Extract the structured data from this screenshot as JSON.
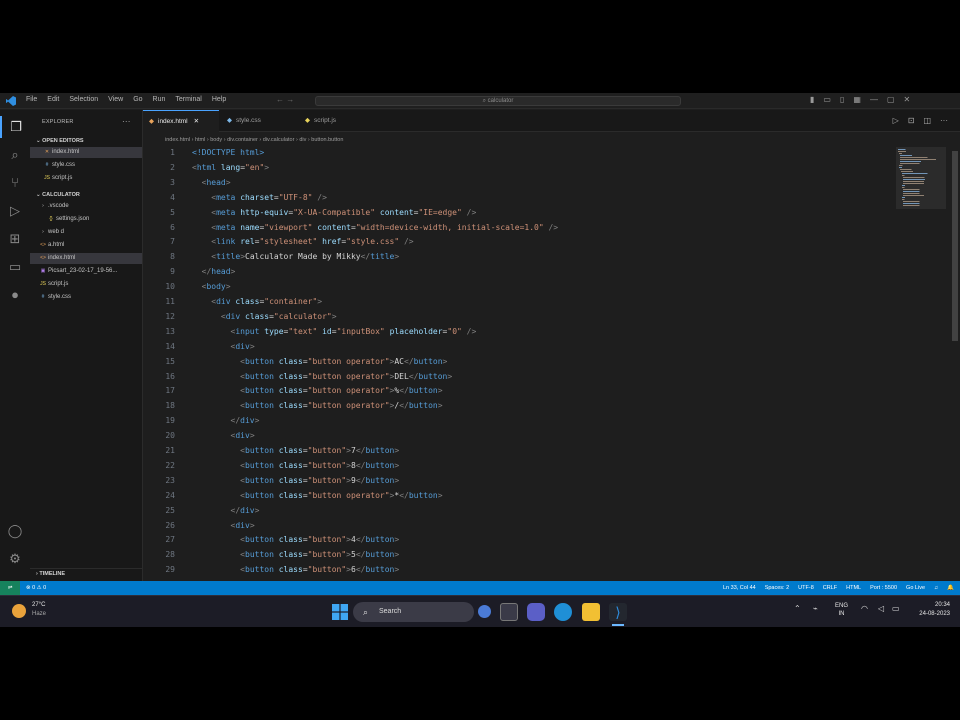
{
  "titlebar": {
    "menu": [
      "File",
      "Edit",
      "Selection",
      "View",
      "Go",
      "Run",
      "Terminal",
      "Help"
    ],
    "search_text": "calculator",
    "nav": "← →",
    "window_controls": [
      "—",
      "▢",
      "✕"
    ]
  },
  "sidebar": {
    "title": "EXPLORER",
    "more": "···",
    "open_editors_header": "OPEN EDITORS",
    "open_editors": [
      {
        "icon": "✕",
        "name": "index.html",
        "color": "#e8a35b"
      },
      {
        "icon": "#",
        "name": "style.css",
        "color": "#7db8e8"
      },
      {
        "icon": "JS",
        "name": "script.js",
        "color": "#e8d35b"
      }
    ],
    "project_header": "CALCULATOR",
    "tree": [
      {
        "icon": "›",
        "name": ".vscode",
        "color": "#c5c5c5",
        "indent": 10
      },
      {
        "icon": "{}",
        "name": "settings.json",
        "color": "#e8d35b",
        "indent": 18
      },
      {
        "icon": "›",
        "name": "web d",
        "color": "#c5c5c5",
        "indent": 10
      },
      {
        "icon": "<>",
        "name": "a.html",
        "color": "#e8a35b",
        "indent": 10
      },
      {
        "icon": "<>",
        "name": "index.html",
        "color": "#e8a35b",
        "indent": 10,
        "selected": true
      },
      {
        "icon": "▣",
        "name": "Picsart_23-02-17_19-56...",
        "color": "#b07de8",
        "indent": 10
      },
      {
        "icon": "JS",
        "name": "script.js",
        "color": "#e8d35b",
        "indent": 10
      },
      {
        "icon": "#",
        "name": "style.css",
        "color": "#7db8e8",
        "indent": 10
      }
    ],
    "timeline": "TIMELINE"
  },
  "tabs": [
    {
      "name": "index.html",
      "close": "✕",
      "active": true,
      "color": "#e8a35b"
    },
    {
      "name": "style.css",
      "close": "",
      "active": false,
      "color": "#7db8e8"
    },
    {
      "name": "script.js",
      "close": "",
      "active": false,
      "color": "#e8d35b"
    }
  ],
  "breadcrumb": [
    "index.html",
    "html",
    "body",
    "div.container",
    "div.calculator",
    "div",
    "button.button"
  ],
  "code_lines": [
    [
      [
        "tg",
        "<!DOCTYPE html>"
      ]
    ],
    [
      [
        "br",
        "<"
      ],
      [
        "tg",
        "html "
      ],
      [
        "at",
        "lang"
      ],
      [
        "tx",
        "="
      ],
      [
        "st",
        "\"en\""
      ],
      [
        "br",
        ">"
      ]
    ],
    [
      [
        "tx",
        "  "
      ],
      [
        "br",
        "<"
      ],
      [
        "tg",
        "head"
      ],
      [
        "br",
        ">"
      ]
    ],
    [
      [
        "tx",
        "    "
      ],
      [
        "br",
        "<"
      ],
      [
        "tg",
        "meta "
      ],
      [
        "at",
        "charset"
      ],
      [
        "tx",
        "="
      ],
      [
        "st",
        "\"UTF-8\""
      ],
      [
        "br",
        " />"
      ]
    ],
    [
      [
        "tx",
        "    "
      ],
      [
        "br",
        "<"
      ],
      [
        "tg",
        "meta "
      ],
      [
        "at",
        "http-equiv"
      ],
      [
        "tx",
        "="
      ],
      [
        "st",
        "\"X-UA-Compatible\""
      ],
      [
        "tx",
        " "
      ],
      [
        "at",
        "content"
      ],
      [
        "tx",
        "="
      ],
      [
        "st",
        "\"IE=edge\""
      ],
      [
        "br",
        " />"
      ]
    ],
    [
      [
        "tx",
        "    "
      ],
      [
        "br",
        "<"
      ],
      [
        "tg",
        "meta "
      ],
      [
        "at",
        "name"
      ],
      [
        "tx",
        "="
      ],
      [
        "st",
        "\"viewport\""
      ],
      [
        "tx",
        " "
      ],
      [
        "at",
        "content"
      ],
      [
        "tx",
        "="
      ],
      [
        "st",
        "\"width=device-width, initial-scale=1.0\""
      ],
      [
        "br",
        " />"
      ]
    ],
    [
      [
        "tx",
        "    "
      ],
      [
        "br",
        "<"
      ],
      [
        "tg",
        "link "
      ],
      [
        "at",
        "rel"
      ],
      [
        "tx",
        "="
      ],
      [
        "st",
        "\"stylesheet\""
      ],
      [
        "tx",
        " "
      ],
      [
        "at",
        "href"
      ],
      [
        "tx",
        "="
      ],
      [
        "st",
        "\"style.css\""
      ],
      [
        "br",
        " />"
      ]
    ],
    [
      [
        "tx",
        "    "
      ],
      [
        "br",
        "<"
      ],
      [
        "tg",
        "title"
      ],
      [
        "br",
        ">"
      ],
      [
        "tx",
        "Calculator Made by Mikky"
      ],
      [
        "br",
        "</"
      ],
      [
        "tg",
        "title"
      ],
      [
        "br",
        ">"
      ]
    ],
    [
      [
        "tx",
        "  "
      ],
      [
        "br",
        "</"
      ],
      [
        "tg",
        "head"
      ],
      [
        "br",
        ">"
      ]
    ],
    [
      [
        "tx",
        "  "
      ],
      [
        "br",
        "<"
      ],
      [
        "tg",
        "body"
      ],
      [
        "br",
        ">"
      ]
    ],
    [
      [
        "tx",
        "    "
      ],
      [
        "br",
        "<"
      ],
      [
        "tg",
        "div "
      ],
      [
        "at",
        "class"
      ],
      [
        "tx",
        "="
      ],
      [
        "st",
        "\"container\""
      ],
      [
        "br",
        ">"
      ]
    ],
    [
      [
        "tx",
        "      "
      ],
      [
        "br",
        "<"
      ],
      [
        "tg",
        "div "
      ],
      [
        "at",
        "class"
      ],
      [
        "tx",
        "="
      ],
      [
        "st",
        "\"calculator\""
      ],
      [
        "br",
        ">"
      ]
    ],
    [
      [
        "tx",
        "        "
      ],
      [
        "br",
        "<"
      ],
      [
        "tg",
        "input "
      ],
      [
        "at",
        "type"
      ],
      [
        "tx",
        "="
      ],
      [
        "st",
        "\"text\""
      ],
      [
        "tx",
        " "
      ],
      [
        "at",
        "id"
      ],
      [
        "tx",
        "="
      ],
      [
        "st",
        "\"inputBox\""
      ],
      [
        "tx",
        " "
      ],
      [
        "at",
        "placeholder"
      ],
      [
        "tx",
        "="
      ],
      [
        "st",
        "\"0\""
      ],
      [
        "br",
        " />"
      ]
    ],
    [
      [
        "tx",
        "        "
      ],
      [
        "br",
        "<"
      ],
      [
        "tg",
        "div"
      ],
      [
        "br",
        ">"
      ]
    ],
    [
      [
        "tx",
        "          "
      ],
      [
        "br",
        "<"
      ],
      [
        "tg",
        "button "
      ],
      [
        "at",
        "class"
      ],
      [
        "tx",
        "="
      ],
      [
        "st",
        "\"button operator\""
      ],
      [
        "br",
        ">"
      ],
      [
        "tx",
        "AC"
      ],
      [
        "br",
        "</"
      ],
      [
        "tg",
        "button"
      ],
      [
        "br",
        ">"
      ]
    ],
    [
      [
        "tx",
        "          "
      ],
      [
        "br",
        "<"
      ],
      [
        "tg",
        "button "
      ],
      [
        "at",
        "class"
      ],
      [
        "tx",
        "="
      ],
      [
        "st",
        "\"button operator\""
      ],
      [
        "br",
        ">"
      ],
      [
        "tx",
        "DEL"
      ],
      [
        "br",
        "</"
      ],
      [
        "tg",
        "button"
      ],
      [
        "br",
        ">"
      ]
    ],
    [
      [
        "tx",
        "          "
      ],
      [
        "br",
        "<"
      ],
      [
        "tg",
        "button "
      ],
      [
        "at",
        "class"
      ],
      [
        "tx",
        "="
      ],
      [
        "st",
        "\"button operator\""
      ],
      [
        "br",
        ">"
      ],
      [
        "tx",
        "%"
      ],
      [
        "br",
        "</"
      ],
      [
        "tg",
        "button"
      ],
      [
        "br",
        ">"
      ]
    ],
    [
      [
        "tx",
        "          "
      ],
      [
        "br",
        "<"
      ],
      [
        "tg",
        "button "
      ],
      [
        "at",
        "class"
      ],
      [
        "tx",
        "="
      ],
      [
        "st",
        "\"button operator\""
      ],
      [
        "br",
        ">"
      ],
      [
        "tx",
        "/"
      ],
      [
        "br",
        "</"
      ],
      [
        "tg",
        "button"
      ],
      [
        "br",
        ">"
      ]
    ],
    [
      [
        "tx",
        "        "
      ],
      [
        "br",
        "</"
      ],
      [
        "tg",
        "div"
      ],
      [
        "br",
        ">"
      ]
    ],
    [
      [
        "tx",
        "        "
      ],
      [
        "br",
        "<"
      ],
      [
        "tg",
        "div"
      ],
      [
        "br",
        ">"
      ]
    ],
    [
      [
        "tx",
        "          "
      ],
      [
        "br",
        "<"
      ],
      [
        "tg",
        "button "
      ],
      [
        "at",
        "class"
      ],
      [
        "tx",
        "="
      ],
      [
        "st",
        "\"button\""
      ],
      [
        "br",
        ">"
      ],
      [
        "tx",
        "7"
      ],
      [
        "br",
        "</"
      ],
      [
        "tg",
        "button"
      ],
      [
        "br",
        ">"
      ]
    ],
    [
      [
        "tx",
        "          "
      ],
      [
        "br",
        "<"
      ],
      [
        "tg",
        "button "
      ],
      [
        "at",
        "class"
      ],
      [
        "tx",
        "="
      ],
      [
        "st",
        "\"button\""
      ],
      [
        "br",
        ">"
      ],
      [
        "tx",
        "8"
      ],
      [
        "br",
        "</"
      ],
      [
        "tg",
        "button"
      ],
      [
        "br",
        ">"
      ]
    ],
    [
      [
        "tx",
        "          "
      ],
      [
        "br",
        "<"
      ],
      [
        "tg",
        "button "
      ],
      [
        "at",
        "class"
      ],
      [
        "tx",
        "="
      ],
      [
        "st",
        "\"button\""
      ],
      [
        "br",
        ">"
      ],
      [
        "tx",
        "9"
      ],
      [
        "br",
        "</"
      ],
      [
        "tg",
        "button"
      ],
      [
        "br",
        ">"
      ]
    ],
    [
      [
        "tx",
        "          "
      ],
      [
        "br",
        "<"
      ],
      [
        "tg",
        "button "
      ],
      [
        "at",
        "class"
      ],
      [
        "tx",
        "="
      ],
      [
        "st",
        "\"button operator\""
      ],
      [
        "br",
        ">"
      ],
      [
        "tx",
        "*"
      ],
      [
        "br",
        "</"
      ],
      [
        "tg",
        "button"
      ],
      [
        "br",
        ">"
      ]
    ],
    [
      [
        "tx",
        "        "
      ],
      [
        "br",
        "</"
      ],
      [
        "tg",
        "div"
      ],
      [
        "br",
        ">"
      ]
    ],
    [
      [
        "tx",
        "        "
      ],
      [
        "br",
        "<"
      ],
      [
        "tg",
        "div"
      ],
      [
        "br",
        ">"
      ]
    ],
    [
      [
        "tx",
        "          "
      ],
      [
        "br",
        "<"
      ],
      [
        "tg",
        "button "
      ],
      [
        "at",
        "class"
      ],
      [
        "tx",
        "="
      ],
      [
        "st",
        "\"button\""
      ],
      [
        "br",
        ">"
      ],
      [
        "tx",
        "4"
      ],
      [
        "br",
        "</"
      ],
      [
        "tg",
        "button"
      ],
      [
        "br",
        ">"
      ]
    ],
    [
      [
        "tx",
        "          "
      ],
      [
        "br",
        "<"
      ],
      [
        "tg",
        "button "
      ],
      [
        "at",
        "class"
      ],
      [
        "tx",
        "="
      ],
      [
        "st",
        "\"button\""
      ],
      [
        "br",
        ">"
      ],
      [
        "tx",
        "5"
      ],
      [
        "br",
        "</"
      ],
      [
        "tg",
        "button"
      ],
      [
        "br",
        ">"
      ]
    ],
    [
      [
        "tx",
        "          "
      ],
      [
        "br",
        "<"
      ],
      [
        "tg",
        "button "
      ],
      [
        "at",
        "class"
      ],
      [
        "tx",
        "="
      ],
      [
        "st",
        "\"button\""
      ],
      [
        "br",
        ">"
      ],
      [
        "tx",
        "6"
      ],
      [
        "br",
        "</"
      ],
      [
        "tg",
        "button"
      ],
      [
        "br",
        ">"
      ]
    ]
  ],
  "statusbar": {
    "left": [
      "⊗ 0 ⚠ 0"
    ],
    "right": [
      "Ln 33, Col 44",
      "Spaces: 2",
      "UTF-8",
      "CRLF",
      "HTML",
      "Port : 5500",
      "Go Live",
      "♫",
      "🔔"
    ]
  },
  "taskbar": {
    "weather_temp": "27°C",
    "weather_desc": "Haze",
    "search_label": "Search",
    "lang_line1": "ENG",
    "lang_line2": "IN",
    "time": "20:34",
    "date": "24-08-2023"
  },
  "colors": {
    "accent": "#007acc",
    "editor_bg": "#1e1e1e",
    "sidebar_bg": "#181818"
  }
}
